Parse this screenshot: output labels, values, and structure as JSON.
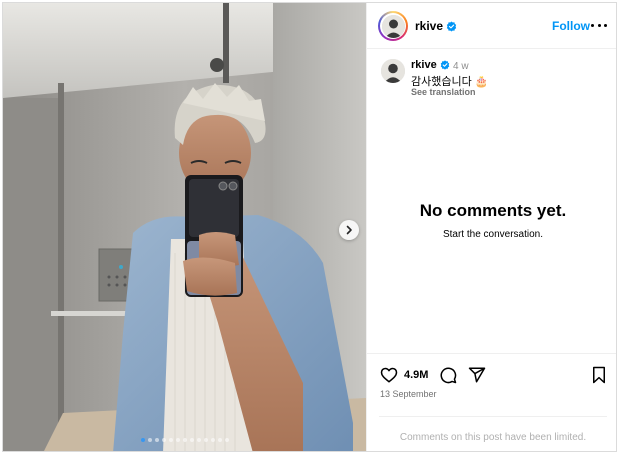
{
  "post": {
    "username": "rkive",
    "verified": true,
    "follow_label": "Follow",
    "more_label": "More options"
  },
  "caption": {
    "username": "rkive",
    "time_ago": "4 w",
    "text": "감사했습니다 🎂",
    "see_translation": "See translation"
  },
  "comments": {
    "empty_title": "No comments yet.",
    "empty_subtitle": "Start the conversation."
  },
  "stats": {
    "likes": "4.9M",
    "date": "13 September"
  },
  "footer": {
    "limited_text": "Comments on this post have been limited."
  },
  "carousel": {
    "total_slides": 13,
    "active_index": 0
  },
  "colors": {
    "accent": "#0095f6",
    "verified": "#0095f6",
    "active_dot": "#3897f0"
  },
  "icons": [
    "chevron-right-icon",
    "verified-badge-icon",
    "more-options-icon",
    "heart-icon",
    "comment-icon",
    "share-icon",
    "bookmark-icon"
  ]
}
